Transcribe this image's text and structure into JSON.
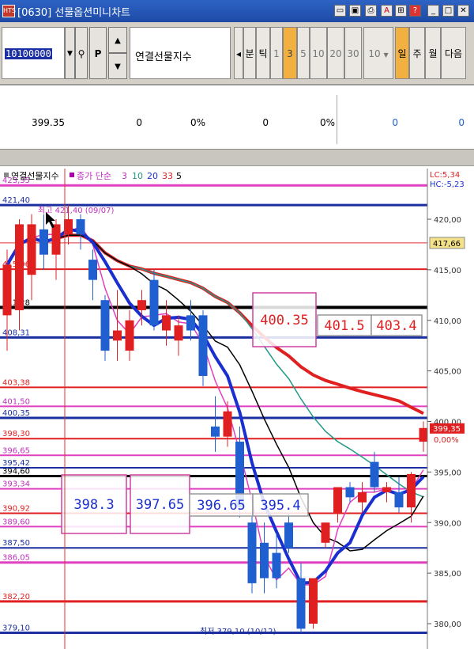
{
  "window": {
    "title": "[0630] 선물옵션미니차트",
    "app_icon_label": "HTS"
  },
  "toolbar": {
    "code_value": "10100000",
    "instrument_name": "연결선물지수",
    "nav_prev": "◂",
    "tabs": [
      "분",
      "틱",
      "1",
      "3",
      "5",
      "10",
      "20",
      "30"
    ],
    "selected_tab": "3",
    "interval_value": "10",
    "period_tabs": [
      "일",
      "주",
      "월"
    ],
    "selected_period": "일",
    "next_label": "다음"
  },
  "info": {
    "price": "399.35",
    "v1": "0",
    "p1": "0%",
    "v2": "0",
    "p2": "0%",
    "v3": "0",
    "v4": "0"
  },
  "legend": {
    "name": "연결선물지수",
    "ma_label": "종가 단순",
    "ma_periods": [
      "3",
      "10",
      "20",
      "33",
      "5"
    ],
    "lc": "LC:5,34",
    "hc": "HC:-5,23"
  },
  "colors": {
    "ma3": "#e040c0",
    "ma10": "#000000",
    "ma20": "#229988",
    "ma33": "#e02020",
    "ma5": "#1a2fd0",
    "up": "#e02020",
    "down": "#1f5fd0"
  },
  "chart_data": {
    "type": "candlestick",
    "y_ticks": [
      "420,00",
      "415,00",
      "410,00",
      "405,00",
      "400,00",
      "395,00",
      "390,00",
      "385,00",
      "380,00"
    ],
    "y_range": [
      378,
      425
    ],
    "current_price_tag": "417,66",
    "last_price_tag": "399,35",
    "last_change_tag": "0,00%",
    "high_annotation": "최고 421,40 (09/07)",
    "low_annotation": "최저 379,10 (10/12)",
    "levels": [
      {
        "value": 423.35,
        "label": "423,35",
        "color": "#e040c0",
        "width": 3
      },
      {
        "value": 421.4,
        "label": "421,40",
        "color": "#1a2fa0",
        "width": 3
      },
      {
        "value": 417.66,
        "label": "",
        "color": "#e03030",
        "width": 1
      },
      {
        "value": 415.06,
        "label": "415,06",
        "color": "#e02020",
        "width": 2
      },
      {
        "value": 411.28,
        "label": "411,28",
        "color": "#000000",
        "width": 4
      },
      {
        "value": 408.31,
        "label": "408,31",
        "color": "#1a2fa0",
        "width": 3
      },
      {
        "value": 403.38,
        "label": "403,38",
        "color": "#e02020",
        "width": 2
      },
      {
        "value": 401.5,
        "label": "401,50",
        "color": "#e040c0",
        "width": 2
      },
      {
        "value": 400.35,
        "label": "400,35",
        "color": "#1a2fa0",
        "width": 3
      },
      {
        "value": 398.3,
        "label": "398,30",
        "color": "#e02020",
        "width": 2
      },
      {
        "value": 396.65,
        "label": "396,65",
        "color": "#e040c0",
        "width": 2
      },
      {
        "value": 395.42,
        "label": "395,42",
        "color": "#1a2fa0",
        "width": 2
      },
      {
        "value": 394.6,
        "label": "394,60",
        "color": "#000000",
        "width": 3
      },
      {
        "value": 393.34,
        "label": "393,34",
        "color": "#e040c0",
        "width": 2
      },
      {
        "value": 390.92,
        "label": "390,92",
        "color": "#e02020",
        "width": 2
      },
      {
        "value": 389.6,
        "label": "389,60",
        "color": "#e040c0",
        "width": 2
      },
      {
        "value": 387.5,
        "label": "387,50",
        "color": "#1a2fa0",
        "width": 2
      },
      {
        "value": 386.05,
        "label": "386,05",
        "color": "#e040c0",
        "width": 3
      },
      {
        "value": 382.2,
        "label": "382,20",
        "color": "#e02020",
        "width": 3
      },
      {
        "value": 379.1,
        "label": "379,10",
        "color": "#1a2fa0",
        "width": 3
      }
    ],
    "candles": [
      {
        "o": 410.5,
        "h": 417,
        "l": 407,
        "c": 415.5
      },
      {
        "o": 411,
        "h": 420,
        "l": 409,
        "c": 419.5
      },
      {
        "o": 414.5,
        "h": 420.5,
        "l": 412,
        "c": 419.5
      },
      {
        "o": 419,
        "h": 420.5,
        "l": 415,
        "c": 416.5
      },
      {
        "o": 416.5,
        "h": 420,
        "l": 414,
        "c": 419.5
      },
      {
        "o": 418.5,
        "h": 421.4,
        "l": 417.5,
        "c": 420
      },
      {
        "o": 420,
        "h": 420.5,
        "l": 417,
        "c": 418.5
      },
      {
        "o": 416,
        "h": 417,
        "l": 412,
        "c": 414
      },
      {
        "o": 412,
        "h": 412.5,
        "l": 406,
        "c": 407
      },
      {
        "o": 408,
        "h": 413,
        "l": 406,
        "c": 409
      },
      {
        "o": 407,
        "h": 411,
        "l": 406,
        "c": 410
      },
      {
        "o": 411,
        "h": 413,
        "l": 409.5,
        "c": 412
      },
      {
        "o": 414,
        "h": 415,
        "l": 409,
        "c": 409.5
      },
      {
        "o": 409,
        "h": 412,
        "l": 407.5,
        "c": 410.5
      },
      {
        "o": 408,
        "h": 410.5,
        "l": 406.5,
        "c": 409.5
      },
      {
        "o": 410.5,
        "h": 412,
        "l": 408,
        "c": 409
      },
      {
        "o": 410.5,
        "h": 411,
        "l": 403.5,
        "c": 404.5
      },
      {
        "o": 399.5,
        "h": 402.5,
        "l": 397,
        "c": 398.5
      },
      {
        "o": 398.5,
        "h": 402,
        "l": 397.5,
        "c": 401
      },
      {
        "o": 398,
        "h": 399.5,
        "l": 390.5,
        "c": 391.5
      },
      {
        "o": 390,
        "h": 391,
        "l": 383,
        "c": 384
      },
      {
        "o": 388,
        "h": 390,
        "l": 383,
        "c": 384.5
      },
      {
        "o": 387,
        "h": 389,
        "l": 383.5,
        "c": 384.5
      },
      {
        "o": 390,
        "h": 391,
        "l": 387,
        "c": 387.5
      },
      {
        "o": 384.5,
        "h": 386,
        "l": 379.1,
        "c": 379.5
      },
      {
        "o": 380,
        "h": 384,
        "l": 379.5,
        "c": 384.5
      },
      {
        "o": 388,
        "h": 390,
        "l": 387.5,
        "c": 390
      },
      {
        "o": 391,
        "h": 393.5,
        "l": 390,
        "c": 393.5
      },
      {
        "o": 393.5,
        "h": 394,
        "l": 392,
        "c": 392.5
      },
      {
        "o": 392,
        "h": 394,
        "l": 391,
        "c": 393
      },
      {
        "o": 396,
        "h": 397,
        "l": 393,
        "c": 393.5
      },
      {
        "o": 393,
        "h": 394,
        "l": 392,
        "c": 393.5
      },
      {
        "o": 393,
        "h": 394.5,
        "l": 391,
        "c": 391.5
      },
      {
        "o": 391.5,
        "h": 395,
        "l": 390,
        "c": 394.8
      },
      {
        "o": 398,
        "h": 400,
        "l": 397,
        "c": 399.35
      }
    ],
    "boxes": [
      {
        "text": "400.35",
        "x1": 320,
        "x2": 400,
        "y1": 370,
        "y2": 438,
        "color": "#d040a0",
        "textcolor": "#e02020"
      },
      {
        "text": "401.5",
        "x1": 402,
        "x2": 470,
        "y1": 398,
        "y2": 424,
        "color": "#999",
        "textcolor": "#e02020"
      },
      {
        "text": "403.4",
        "x1": 470,
        "x2": 534,
        "y1": 398,
        "y2": 424,
        "color": "#999",
        "textcolor": "#e02020"
      },
      {
        "text": "398.3",
        "x1": 78,
        "x2": 160,
        "y1": 600,
        "y2": 674,
        "color": "#d040a0",
        "textcolor": "#1a2fd0"
      },
      {
        "text": "397.65",
        "x1": 165,
        "x2": 240,
        "y1": 600,
        "y2": 674,
        "color": "#d040a0",
        "textcolor": "#1a2fd0"
      },
      {
        "text": "396.65",
        "x1": 240,
        "x2": 320,
        "y1": 624,
        "y2": 652,
        "color": "#999",
        "textcolor": "#1a2fd0"
      },
      {
        "text": "395.4",
        "x1": 320,
        "x2": 390,
        "y1": 624,
        "y2": 652,
        "color": "#999",
        "textcolor": "#1a2fd0"
      }
    ]
  }
}
